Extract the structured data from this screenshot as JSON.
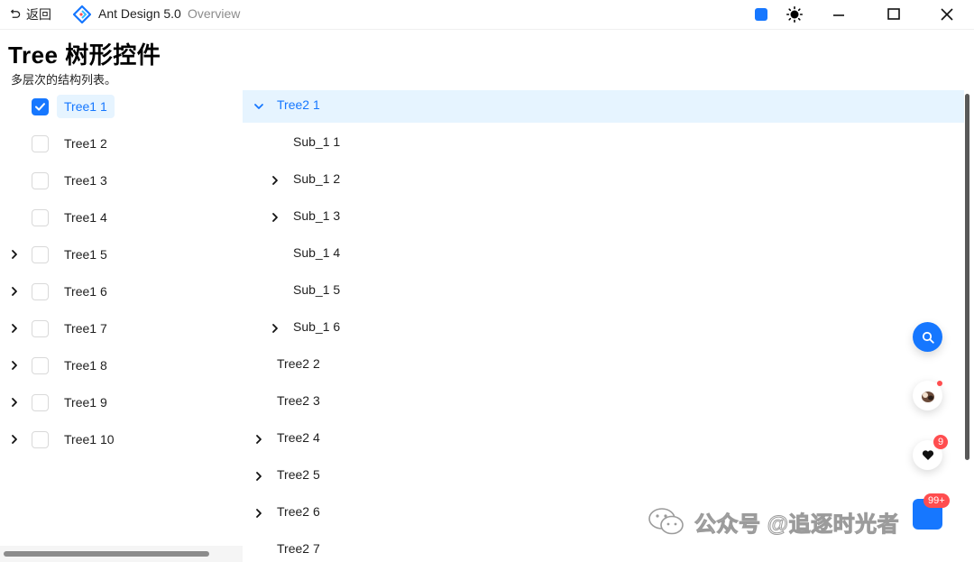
{
  "titlebar": {
    "back_label": "返回",
    "app_name": "Ant Design 5.0",
    "subtitle": "Overview"
  },
  "page": {
    "title": "Tree 树形控件",
    "description": "多层次的结构列表。"
  },
  "tree1": {
    "items": [
      {
        "label": "Tree1 1",
        "checked": true,
        "selected": true,
        "expandable": false
      },
      {
        "label": "Tree1 2",
        "checked": false,
        "selected": false,
        "expandable": false
      },
      {
        "label": "Tree1 3",
        "checked": false,
        "selected": false,
        "expandable": false
      },
      {
        "label": "Tree1 4",
        "checked": false,
        "selected": false,
        "expandable": false
      },
      {
        "label": "Tree1 5",
        "checked": false,
        "selected": false,
        "expandable": true
      },
      {
        "label": "Tree1 6",
        "checked": false,
        "selected": false,
        "expandable": true
      },
      {
        "label": "Tree1 7",
        "checked": false,
        "selected": false,
        "expandable": true
      },
      {
        "label": "Tree1 8",
        "checked": false,
        "selected": false,
        "expandable": true
      },
      {
        "label": "Tree1 9",
        "checked": false,
        "selected": false,
        "expandable": true
      },
      {
        "label": "Tree1 10",
        "checked": false,
        "selected": false,
        "expandable": true
      }
    ]
  },
  "tree2": {
    "items": [
      {
        "label": "Tree2 1",
        "level": 0,
        "switcher": "expanded",
        "selected": true
      },
      {
        "label": "Sub_1 1",
        "level": 1,
        "switcher": "none",
        "selected": false
      },
      {
        "label": "Sub_1 2",
        "level": 1,
        "switcher": "collapsed",
        "selected": false
      },
      {
        "label": "Sub_1 3",
        "level": 1,
        "switcher": "collapsed",
        "selected": false
      },
      {
        "label": "Sub_1 4",
        "level": 1,
        "switcher": "none",
        "selected": false
      },
      {
        "label": "Sub_1 5",
        "level": 1,
        "switcher": "none",
        "selected": false
      },
      {
        "label": "Sub_1 6",
        "level": 1,
        "switcher": "collapsed",
        "selected": false
      },
      {
        "label": "Tree2 2",
        "level": 0,
        "switcher": "none",
        "selected": false
      },
      {
        "label": "Tree2 3",
        "level": 0,
        "switcher": "none",
        "selected": false
      },
      {
        "label": "Tree2 4",
        "level": 0,
        "switcher": "collapsed",
        "selected": false
      },
      {
        "label": "Tree2 5",
        "level": 0,
        "switcher": "collapsed",
        "selected": false
      },
      {
        "label": "Tree2 6",
        "level": 0,
        "switcher": "collapsed",
        "selected": false
      },
      {
        "label": "Tree2 7",
        "level": 0,
        "switcher": "none",
        "selected": false
      }
    ]
  },
  "float_buttons": {
    "heart_badge": "9",
    "bottom_badge": "99+"
  },
  "watermark": {
    "text": "公众号 @追逐时光者"
  },
  "colors": {
    "primary": "#1677ff",
    "selected_bg": "#e6f4ff",
    "badge": "#ff4d4f"
  },
  "icons": {
    "back": "undo-icon",
    "logo": "ant-design-logo-icon",
    "theme": "sun-icon",
    "search": "search-icon",
    "heart": "heart-icon"
  }
}
